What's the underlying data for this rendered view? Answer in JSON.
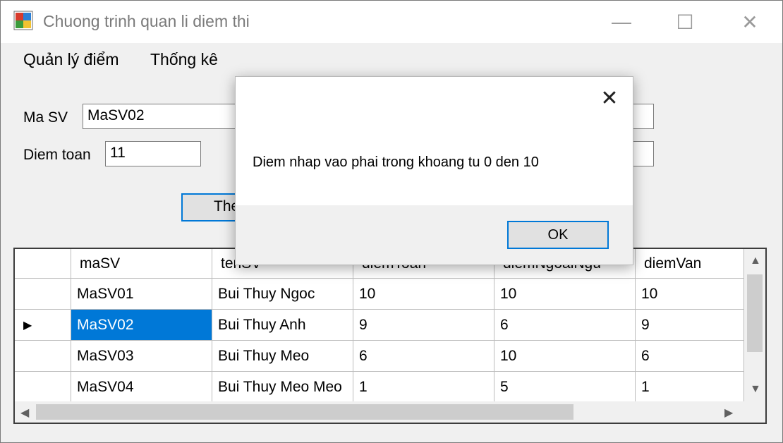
{
  "window": {
    "title": "Chuong trinh quan li diem thi",
    "minimize_glyph": "—",
    "maximize_glyph": "☐",
    "close_glyph": "✕"
  },
  "menu": [
    "Quản lý điểm",
    "Thống kê"
  ],
  "form": {
    "masv_label": "Ma SV",
    "masv_value": "MaSV02",
    "diemtoan_label": "Diem toan",
    "diemtoan_value": "11",
    "button_partial_label": "The"
  },
  "grid": {
    "columns": [
      "maSV",
      "tenSV",
      "diemToan",
      "diemNgoaiNgu",
      "diemVan"
    ],
    "rows": [
      [
        "MaSV01",
        "Bui Thuy Ngoc",
        "10",
        "10",
        "10"
      ],
      [
        "MaSV02",
        "Bui Thuy Anh",
        "9",
        "6",
        "9"
      ],
      [
        "MaSV03",
        "Bui Thuy Meo",
        "6",
        "10",
        "6"
      ],
      [
        "MaSV04",
        "Bui Thuy Meo Meo",
        "1",
        "5",
        "1"
      ]
    ],
    "current_row_marker": "▶",
    "selected_row": 1
  },
  "dialog": {
    "message": "Diem nhap vao phai trong khoang tu 0 den 10",
    "ok_label": "OK",
    "close_glyph": "✕"
  }
}
